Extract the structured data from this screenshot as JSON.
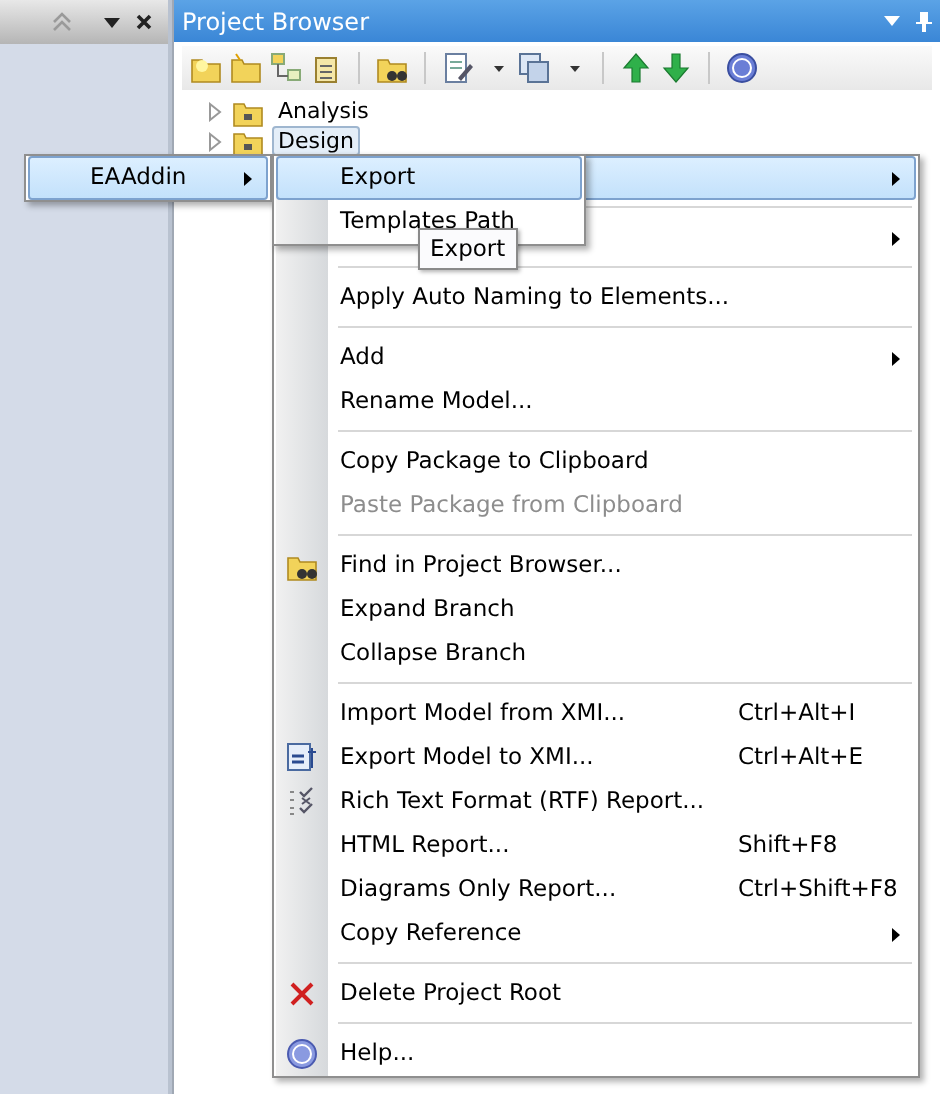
{
  "project_browser": {
    "title": "Project Browser",
    "tree": [
      {
        "label": "Analysis",
        "expanded": false,
        "selected": false
      },
      {
        "label": "Design",
        "expanded": false,
        "selected": true
      }
    ]
  },
  "context_menu": {
    "items": [
      {
        "kind": "item",
        "selected": true,
        "submenu": true
      },
      {
        "kind": "separator"
      },
      {
        "kind": "item",
        "selected": false,
        "submenu": true
      },
      {
        "kind": "separator"
      },
      {
        "kind": "item",
        "label": "Apply Auto Naming to Elements...",
        "selected": false
      },
      {
        "kind": "separator"
      },
      {
        "kind": "item",
        "label": "Add",
        "selected": false,
        "submenu": true
      },
      {
        "kind": "item",
        "label": "Rename Model...",
        "selected": false
      },
      {
        "kind": "separator"
      },
      {
        "kind": "item",
        "label": "Copy Package to Clipboard",
        "selected": false
      },
      {
        "kind": "item",
        "label": "Paste Package from Clipboard",
        "selected": false,
        "disabled": true
      },
      {
        "kind": "separator"
      },
      {
        "kind": "item",
        "label": "Find in Project Browser...",
        "selected": false
      },
      {
        "kind": "item",
        "label": "Expand Branch",
        "selected": false
      },
      {
        "kind": "item",
        "label": "Collapse Branch",
        "selected": false
      },
      {
        "kind": "separator"
      },
      {
        "kind": "item",
        "label": "Import Model from XMI...",
        "shortcut": "Ctrl+Alt+I",
        "selected": false
      },
      {
        "kind": "item",
        "label": "Export Model to XMI...",
        "shortcut": "Ctrl+Alt+E",
        "selected": false
      },
      {
        "kind": "item",
        "label": "Rich Text Format (RTF) Report...",
        "selected": false
      },
      {
        "kind": "item",
        "label": "HTML Report...",
        "shortcut": "Shift+F8",
        "selected": false
      },
      {
        "kind": "item",
        "label": "Diagrams Only Report...",
        "shortcut": "Ctrl+Shift+F8",
        "selected": false
      },
      {
        "kind": "item",
        "label": "Copy Reference",
        "selected": false,
        "submenu": true
      },
      {
        "kind": "separator"
      },
      {
        "kind": "item",
        "label": "Delete Project Root",
        "selected": false
      },
      {
        "kind": "separator"
      },
      {
        "kind": "item",
        "label": "Help...",
        "selected": false
      }
    ]
  },
  "addin_menu": {
    "items": [
      {
        "kind": "item",
        "label": "EAAddin",
        "selected": true,
        "submenu": true
      }
    ]
  },
  "addin_submenu": {
    "items": [
      {
        "kind": "item",
        "label": "Export",
        "selected": true
      },
      {
        "kind": "item",
        "label": "Templates Path",
        "selected": false
      }
    ]
  },
  "tooltip": {
    "text": "Export"
  }
}
